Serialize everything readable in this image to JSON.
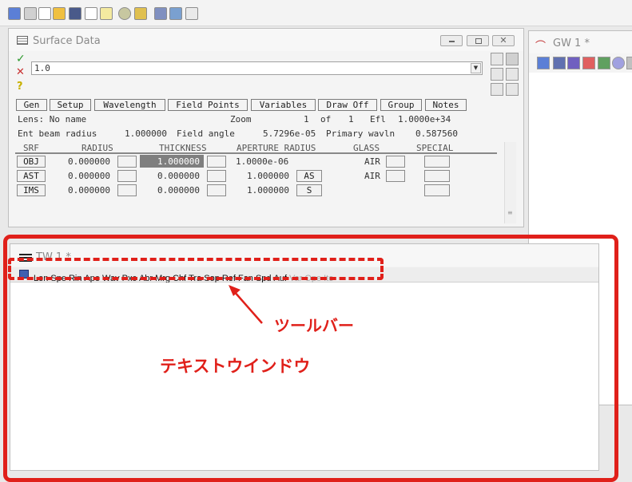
{
  "surface_window": {
    "title": "Surface Data",
    "edit_value": "1.0",
    "nav_buttons": [
      "Gen",
      "Setup",
      "Wavelength",
      "Field Points",
      "Variables",
      "Draw Off",
      "Group",
      "Notes"
    ],
    "lens_line": {
      "lens": "Lens: No name",
      "zoom_label": "Zoom",
      "zoom_current": "1",
      "of": "of",
      "zoom_total": "1",
      "efl_label": "Efl",
      "efl_value": "1.0000e+34"
    },
    "beam_line": {
      "ent_label": "Ent beam radius",
      "ent_value": "1.000000",
      "field_label": "Field angle",
      "field_value": "5.7296e-05",
      "wavln_label": "Primary wavln",
      "wavln_value": "0.587560"
    },
    "headers": [
      "SRF",
      "RADIUS",
      "THICKNESS",
      "APERTURE RADIUS",
      "GLASS",
      "SPECIAL"
    ],
    "rows": [
      {
        "srf": "OBJ",
        "radius": "0.000000",
        "thickness": "1.000000",
        "aperture": "1.0000e-06",
        "ap_flag": "",
        "glass": "AIR"
      },
      {
        "srf": "AST",
        "radius": "0.000000",
        "thickness": "0.000000",
        "aperture": "1.000000",
        "ap_flag": "AS",
        "glass": "AIR"
      },
      {
        "srf": "IMS",
        "radius": "0.000000",
        "thickness": "0.000000",
        "aperture": "1.000000",
        "ap_flag": "S",
        "glass": ""
      }
    ]
  },
  "gw_window": {
    "title": "GW 1 *"
  },
  "tw_window": {
    "title": "TW 1 *",
    "toolbar_items": [
      "Len",
      "Spe",
      "Rin",
      "Ape",
      "Wav",
      "Pxc",
      "Abr",
      "Mrg",
      "Chf",
      "Tra",
      "Sop",
      "Ref",
      "Fan",
      "Spd",
      "Auf"
    ],
    "toolbar_disabled": [
      "Var",
      "Ope",
      "Ite"
    ]
  },
  "annotations": {
    "toolbar_label": "ツールバー",
    "text_window_label": "テキストウインドウ",
    "color": "#e0201a"
  },
  "colors": {
    "selected_cell": "#7f7f7f",
    "check": "#2f9a2f",
    "cross": "#c83030"
  }
}
